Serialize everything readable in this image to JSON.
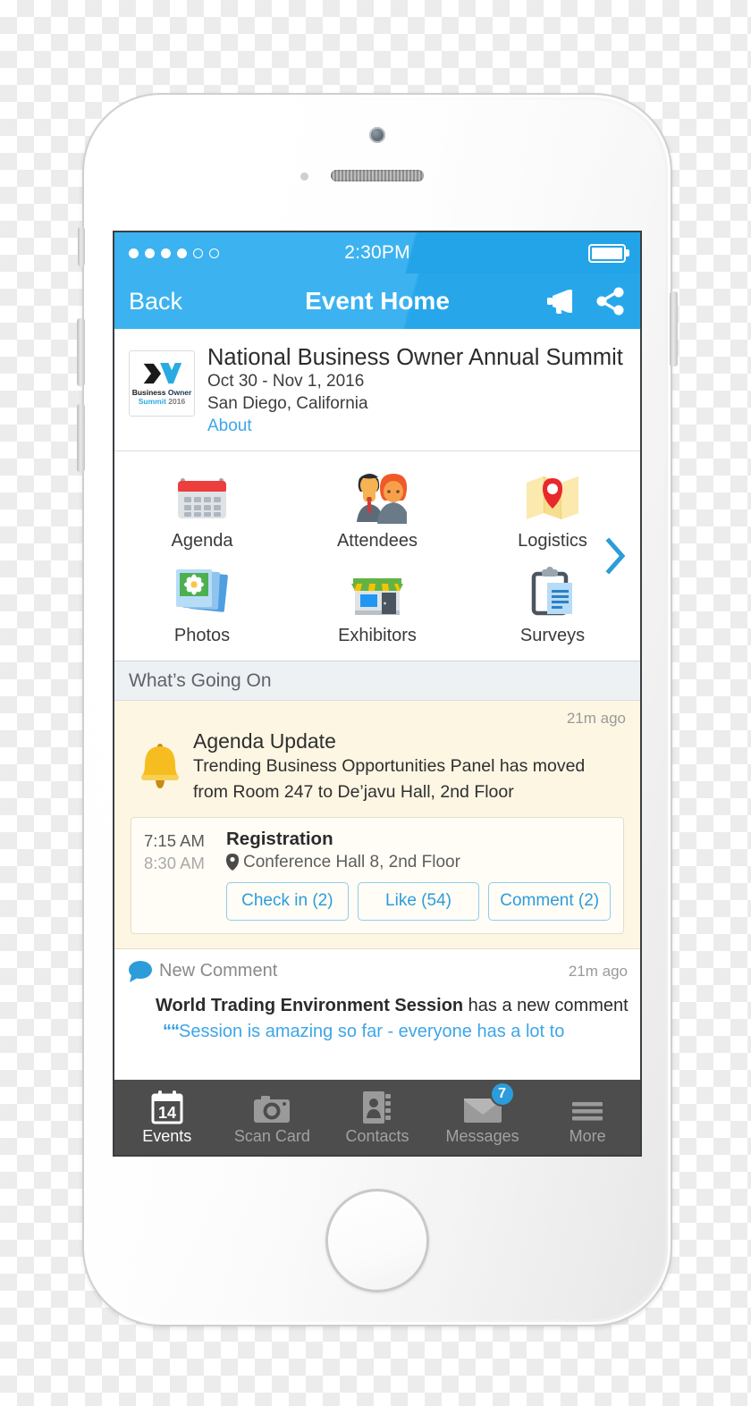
{
  "status_bar": {
    "signal_dots_filled": 4,
    "signal_dots_total": 6,
    "time": "2:30PM",
    "battery_icon": "battery-full-icon"
  },
  "nav_bar": {
    "back_label": "Back",
    "title": "Event Home",
    "announce_icon": "megaphone-icon",
    "share_icon": "share-icon",
    "background_color": "#3cb3f0"
  },
  "event": {
    "logo": {
      "mark": "business-owner-summit-logo",
      "line1_bold": "Business",
      "line1_accent": " Owner",
      "line2_accent": "Summit",
      "line2_muted": " 2016"
    },
    "title": "National Business Owner Annual Summit",
    "dates": "Oct 30 - Nov 1, 2016",
    "location": "San Diego, California",
    "about_link": "About"
  },
  "grid": {
    "next_icon": "chevron-right-icon",
    "items": [
      {
        "label": "Agenda",
        "icon": "calendar-icon"
      },
      {
        "label": "Attendees",
        "icon": "people-icon"
      },
      {
        "label": "Logistics",
        "icon": "map-pin-icon"
      },
      {
        "label": "Photos",
        "icon": "photos-icon"
      },
      {
        "label": "Exhibitors",
        "icon": "storefront-icon"
      },
      {
        "label": "Surveys",
        "icon": "clipboard-icon"
      }
    ]
  },
  "feed": {
    "section_title": "What’s Going On",
    "notification": {
      "icon": "bell-icon",
      "time_ago": "21m ago",
      "title": "Agenda Update",
      "description_line1": "Trending Business Opportunities Panel has moved",
      "description_line2": "from Room 247 to De’javu Hall, 2nd Floor",
      "session": {
        "time_start": "7:15 AM",
        "time_end": "8:30 AM",
        "title": "Registration",
        "location_icon": "location-pin-icon",
        "location": "Conference Hall 8, 2nd Floor",
        "actions": [
          {
            "label": "Check in (2)"
          },
          {
            "label": "Like (54)"
          },
          {
            "label": "Comment (2)"
          }
        ]
      }
    },
    "comment": {
      "icon": "speech-bubble-icon",
      "label": "New Comment",
      "time_ago": "21m ago",
      "subject": "World Trading Environment Session",
      "suffix": " has a new comment",
      "quote_mark": "““",
      "quote": "Session is amazing so far - everyone has a lot to"
    }
  },
  "tab_bar": {
    "background_color": "#4d4d4d",
    "badge_color": "#2d9cdb",
    "tabs": [
      {
        "label": "Events",
        "icon": "calendar-14-icon",
        "active": true,
        "badge": null
      },
      {
        "label": "Scan Card",
        "icon": "camera-icon",
        "active": false,
        "badge": null
      },
      {
        "label": "Contacts",
        "icon": "address-book-icon",
        "active": false,
        "badge": null
      },
      {
        "label": "Messages",
        "icon": "envelope-icon",
        "active": false,
        "badge": "7"
      },
      {
        "label": "More",
        "icon": "hamburger-icon",
        "active": false,
        "badge": null
      }
    ]
  },
  "device": {
    "camera_icon": "front-camera",
    "speaker_icon": "earpiece-speaker",
    "home_button": "home-button"
  }
}
